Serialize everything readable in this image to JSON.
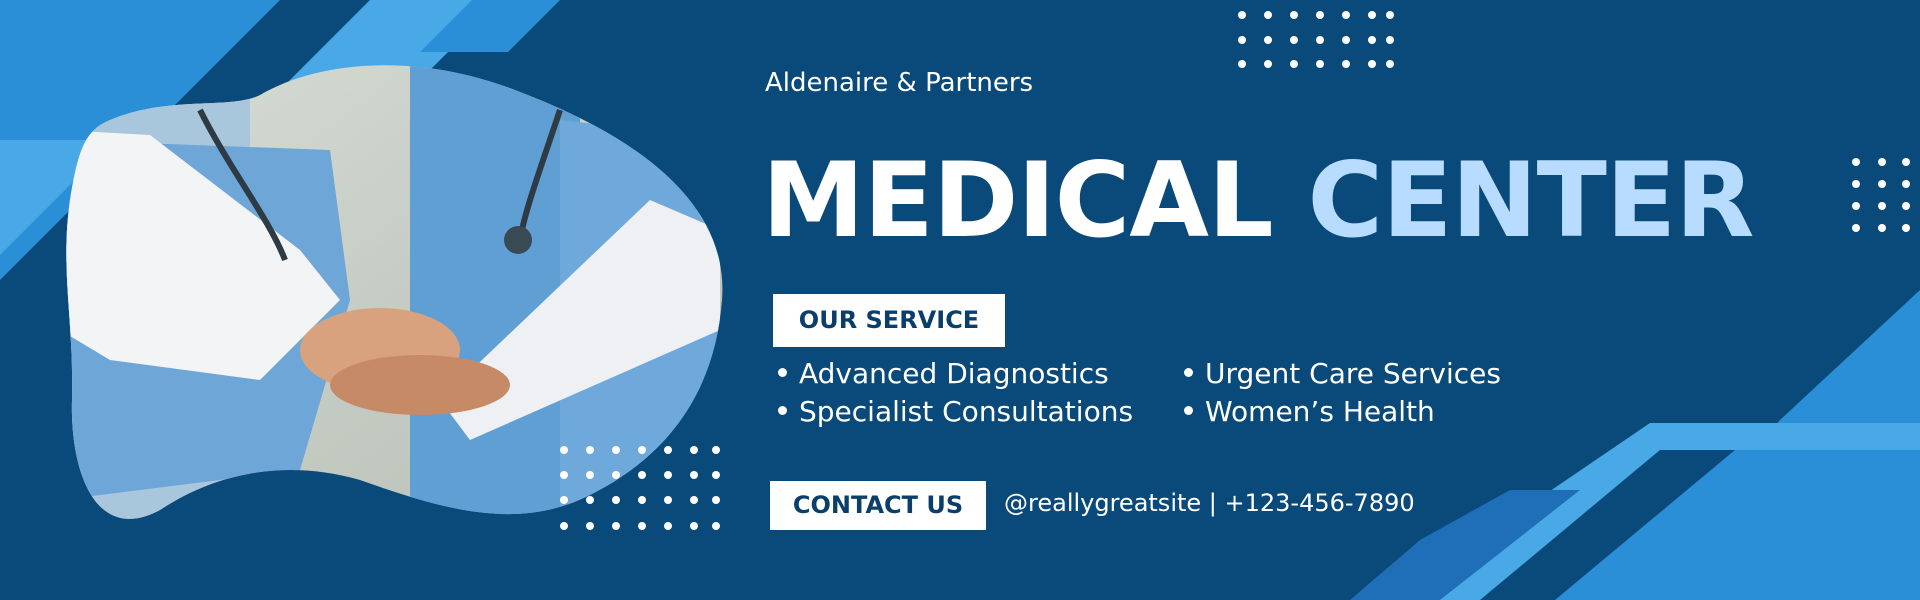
{
  "brand": {
    "name": "Aldenaire & Partners"
  },
  "headline": {
    "word1": "MEDICAL",
    "word2": "CENTER"
  },
  "services": {
    "heading": "OUR SERVICE",
    "items": [
      "Advanced Diagnostics",
      "Specialist Consultations",
      "Urgent Care Services",
      "Women’s Health"
    ]
  },
  "contact": {
    "button_label": "CONTACT US",
    "info": "@reallygreatsite | +123-456-7890"
  },
  "photo": {
    "subject": "medical staff stacking hands"
  },
  "colors": {
    "background": "#0a4a7a",
    "accent_light": "#b7dcff",
    "stripe_bright": "#48a9e6",
    "stripe_mid": "#2a8fd6",
    "tag_text": "#0b3f6b"
  }
}
